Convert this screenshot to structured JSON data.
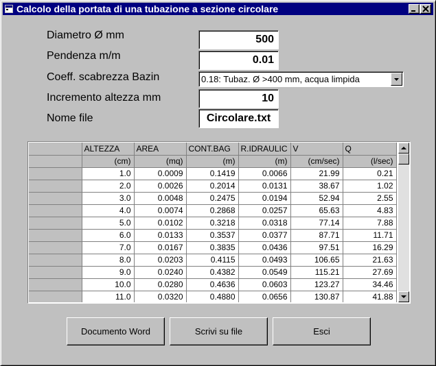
{
  "window": {
    "title": "Calcolo della portata di una tubazione a sezione circolare",
    "controls": [
      "minimize-icon",
      "maximize-icon",
      "close-icon"
    ]
  },
  "form": {
    "diametro_label": "Diametro Ø mm",
    "diametro_value": "500",
    "pendenza_label": "Pendenza m/m",
    "pendenza_value": "0.01",
    "coeff_label": "Coeff. scabrezza Bazin",
    "coeff_value": "0.18: Tubaz. Ø >400 mm, acqua limpida",
    "incremento_label": "Incremento altezza mm",
    "incremento_value": "10",
    "nome_file_label": "Nome file",
    "nome_file_value": "Circolare.txt"
  },
  "table": {
    "columns": [
      {
        "header": "ALTEZZA",
        "unit": "(cm)"
      },
      {
        "header": "AREA",
        "unit": "(mq)"
      },
      {
        "header": "CONT.BAG",
        "unit": "(m)"
      },
      {
        "header": "R.IDRAULIC",
        "unit": "(m)"
      },
      {
        "header": "V",
        "unit": "(cm/sec)"
      },
      {
        "header": "Q",
        "unit": "(l/sec)"
      }
    ],
    "rows": [
      [
        "1.0",
        "0.0009",
        "0.1419",
        "0.0066",
        "21.99",
        "0.21"
      ],
      [
        "2.0",
        "0.0026",
        "0.2014",
        "0.0131",
        "38.67",
        "1.02"
      ],
      [
        "3.0",
        "0.0048",
        "0.2475",
        "0.0194",
        "52.94",
        "2.55"
      ],
      [
        "4.0",
        "0.0074",
        "0.2868",
        "0.0257",
        "65.63",
        "4.83"
      ],
      [
        "5.0",
        "0.0102",
        "0.3218",
        "0.0318",
        "77.14",
        "7.88"
      ],
      [
        "6.0",
        "0.0133",
        "0.3537",
        "0.0377",
        "87.71",
        "11.71"
      ],
      [
        "7.0",
        "0.0167",
        "0.3835",
        "0.0436",
        "97.51",
        "16.29"
      ],
      [
        "8.0",
        "0.0203",
        "0.4115",
        "0.0493",
        "106.65",
        "21.63"
      ],
      [
        "9.0",
        "0.0240",
        "0.4382",
        "0.0549",
        "115.21",
        "27.69"
      ],
      [
        "10.0",
        "0.0280",
        "0.4636",
        "0.0603",
        "123.27",
        "34.46"
      ],
      [
        "11.0",
        "0.0320",
        "0.4880",
        "0.0656",
        "130.87",
        "41.88"
      ]
    ]
  },
  "buttons": {
    "word": "Documento Word",
    "scrivi": "Scrivi su file",
    "esci": "Esci"
  },
  "colors": {
    "titlebar": "#000080",
    "face": "#c0c0c0"
  }
}
